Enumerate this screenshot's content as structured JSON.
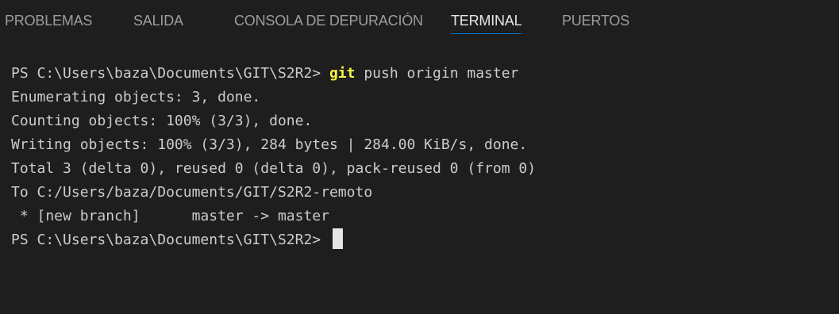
{
  "tabs": [
    {
      "label": "PROBLEMAS",
      "active": false
    },
    {
      "label": "SALIDA",
      "active": false
    },
    {
      "label": "CONSOLA DE DEPURACIÓN",
      "active": false
    },
    {
      "label": "TERMINAL",
      "active": true
    },
    {
      "label": "PUERTOS",
      "active": false
    }
  ],
  "colors": {
    "background": "#1e1e1e",
    "text": "#cccccc",
    "tab_inactive": "#9d9d9d",
    "tab_active": "#e7e7e7",
    "tab_underline": "#0078d4",
    "command_highlight": "#f5f543",
    "cursor": "#e6e6e6"
  },
  "terminal": {
    "prompt1": "PS C:\\Users\\baza\\Documents\\GIT\\S2R2> ",
    "command_name": "git",
    "command_args": " push origin master",
    "output": [
      "Enumerating objects: 3, done.",
      "Counting objects: 100% (3/3), done.",
      "Writing objects: 100% (3/3), 284 bytes | 284.00 KiB/s, done.",
      "Total 3 (delta 0), reused 0 (delta 0), pack-reused 0 (from 0)",
      "To C:/Users/baza/Documents/GIT/S2R2-remoto",
      " * [new branch]      master -> master"
    ],
    "prompt2": "PS C:\\Users\\baza\\Documents\\GIT\\S2R2> "
  }
}
